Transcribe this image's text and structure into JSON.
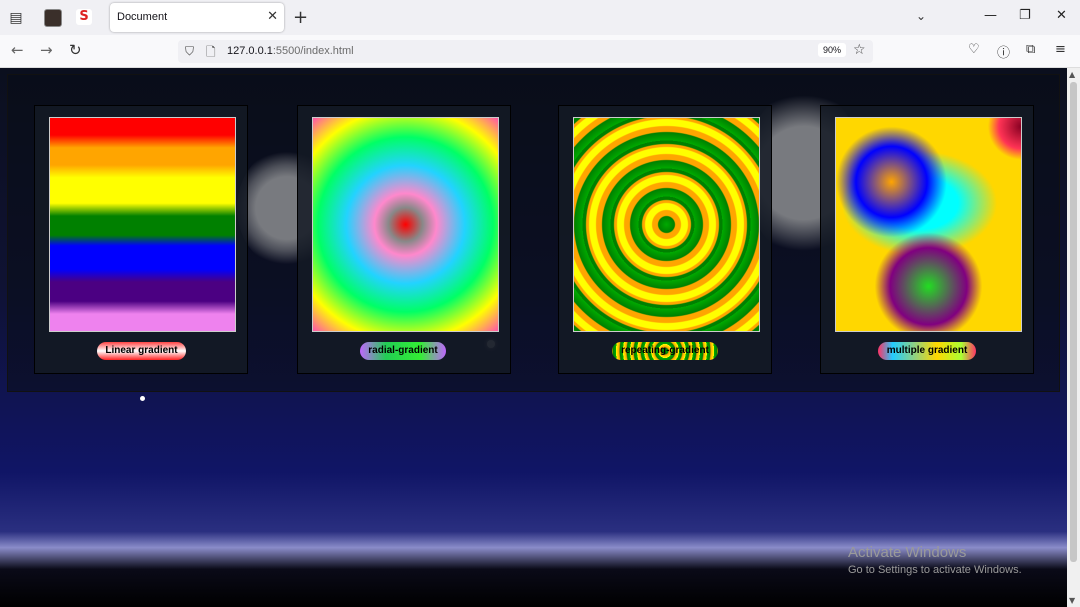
{
  "browser": {
    "tab": {
      "title": "Document"
    },
    "url": {
      "host": "127.0.0.1",
      "path": ":5500/index.html"
    },
    "zoom": "90%"
  },
  "cards": [
    {
      "label": "Linear gradient"
    },
    {
      "label": "radial-gradient"
    },
    {
      "label": "repeating-gradient"
    },
    {
      "label": "multiple gradient"
    }
  ],
  "watermark": {
    "line1": "Activate Windows",
    "line2": "Go to Settings to activate Windows."
  },
  "colors": {
    "chrome": "#f0f0f4",
    "page_background_top": "#0b0f1e",
    "page_background_bottom": "#101566"
  }
}
